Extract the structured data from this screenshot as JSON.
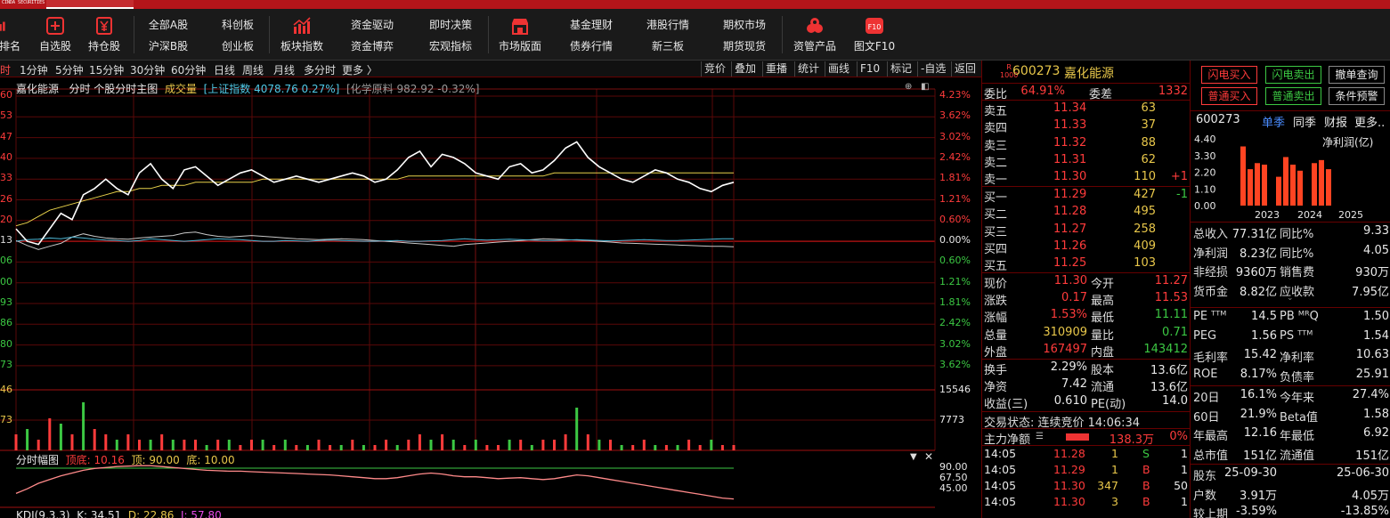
{
  "app": {
    "brand": "CINDA SECURITIES",
    "toolbar": {
      "rank": "排名",
      "watchlist": "自选股",
      "holdings": "持仓股",
      "all_a": "全部A股",
      "sh_sz_b": "沪深B股",
      "star": "科创板",
      "gem": "创业板",
      "sector_index": "板块指数",
      "capital_drive": "资金驱动",
      "capital_game": "资金博弈",
      "instant": "即时决策",
      "macro": "宏观指标",
      "market_board": "市场版面",
      "fund": "基金理财",
      "bond": "债券行情",
      "hk": "港股行情",
      "neeq": "新三板",
      "options": "期权市场",
      "futures": "期货现货",
      "asset_mgmt": "资管产品",
      "f10": "图文F10"
    }
  },
  "periods": {
    "items": [
      "时",
      "1分钟",
      "5分钟",
      "15分钟",
      "30分钟",
      "60分钟",
      "日线",
      "周线",
      "月线",
      "多分时",
      "更多 〉"
    ],
    "tools": [
      "竞价",
      "叠加",
      "重播",
      "统计",
      "画线",
      "F10",
      "标记",
      "-自选",
      "返回"
    ]
  },
  "chart_header": {
    "stock": "嘉化能源",
    "mode": "分时 个股分时主图",
    "vol": "成交量",
    "sh_index": "[上证指数 4078.76 0.27%]",
    "sector": "[化学原料 982.92 -0.32%]"
  },
  "chart_data": {
    "type": "line",
    "left_price_ticks": [
      "60",
      "53",
      "47",
      "40",
      "33",
      "26",
      "20",
      "13",
      "06",
      "00",
      "93",
      "86",
      "80",
      "73"
    ],
    "right_pct_ticks": [
      "4.23%",
      "3.62%",
      "3.02%",
      "2.42%",
      "1.81%",
      "1.21%",
      "0.60%",
      "0.00%",
      "0.60%",
      "1.21%",
      "1.81%",
      "2.42%",
      "3.02%",
      "3.62%"
    ],
    "volume_left_ticks": [
      "46",
      "73"
    ],
    "volume_right_ticks": [
      "15546",
      "7773"
    ],
    "price_series": [
      11.17,
      11.13,
      11.12,
      11.17,
      11.22,
      11.2,
      11.28,
      11.3,
      11.33,
      11.3,
      11.28,
      11.35,
      11.38,
      11.33,
      11.3,
      11.36,
      11.37,
      11.34,
      11.31,
      11.33,
      11.35,
      11.36,
      11.34,
      11.32,
      11.33,
      11.34,
      11.33,
      11.32,
      11.33,
      11.34,
      11.35,
      11.34,
      11.32,
      11.33,
      11.36,
      11.4,
      11.42,
      11.37,
      11.41,
      11.4,
      11.38,
      11.35,
      11.34,
      11.33,
      11.37,
      11.38,
      11.35,
      11.36,
      11.39,
      11.43,
      11.45,
      11.4,
      11.37,
      11.35,
      11.33,
      11.32,
      11.34,
      11.36,
      11.35,
      11.33,
      11.32,
      11.3,
      11.29,
      11.31,
      11.32
    ],
    "avg_series": [
      11.18,
      11.19,
      11.21,
      11.23,
      11.24,
      11.25,
      11.26,
      11.27,
      11.28,
      11.29,
      11.29,
      11.3,
      11.3,
      11.31,
      11.31,
      11.31,
      11.32,
      11.32,
      11.32,
      11.32,
      11.32,
      11.32,
      11.33,
      11.33,
      11.33,
      11.33,
      11.33,
      11.33,
      11.33,
      11.33,
      11.33,
      11.33,
      11.33,
      11.33,
      11.33,
      11.34,
      11.34,
      11.34,
      11.34,
      11.34,
      11.34,
      11.34,
      11.34,
      11.34,
      11.34,
      11.34,
      11.34,
      11.34,
      11.35,
      11.35,
      11.35,
      11.35,
      11.35,
      11.35,
      11.35,
      11.35,
      11.35,
      11.35,
      11.35,
      11.35,
      11.35,
      11.35,
      11.35,
      11.35,
      11.35
    ],
    "index_series": [
      0.0,
      0.04,
      0.05,
      0.08,
      0.06,
      0.1,
      0.08,
      0.05,
      0.03,
      0.02,
      0.0,
      0.02,
      0.06,
      0.04,
      0.02,
      0.0,
      0.02,
      0.04,
      0.06,
      0.05,
      0.04,
      0.02,
      0.0,
      0.0,
      0.02,
      0.01,
      0.0,
      0.02,
      0.03,
      0.02,
      0.01,
      0.0,
      0.0,
      0.01,
      0.02,
      0.0,
      0.0,
      0.01,
      0.02,
      0.04,
      0.06,
      0.04,
      0.03,
      0.04,
      0.05,
      0.04,
      0.03,
      0.02,
      0.02,
      0.03,
      0.04,
      0.03,
      0.02,
      0.01,
      0.02,
      0.03,
      0.04,
      0.03,
      0.02,
      0.02,
      0.03,
      0.04,
      0.05,
      0.06,
      0.06
    ],
    "sector_series": [
      0.02,
      -0.1,
      -0.2,
      -0.12,
      -0.05,
      0.1,
      0.18,
      0.12,
      0.08,
      0.06,
      0.05,
      0.08,
      0.1,
      0.12,
      0.14,
      0.2,
      0.22,
      0.16,
      0.12,
      0.1,
      0.12,
      0.14,
      0.12,
      0.1,
      0.08,
      0.06,
      0.05,
      0.04,
      0.05,
      0.06,
      0.05,
      0.04,
      0.02,
      0.0,
      -0.02,
      -0.04,
      -0.06,
      -0.08,
      -0.1,
      -0.12,
      -0.08,
      -0.06,
      -0.04,
      -0.02,
      0.0,
      0.02,
      0.04,
      0.06,
      0.05,
      0.04,
      0.03,
      0.02,
      0.0,
      -0.02,
      -0.04,
      -0.05,
      -0.06,
      -0.07,
      -0.08,
      -0.09,
      -0.1,
      -0.11,
      -0.12,
      -0.12,
      -0.13
    ],
    "volume": [
      3,
      4,
      2,
      6,
      5,
      3,
      9,
      4,
      3,
      2,
      3,
      2,
      2,
      3,
      2,
      2,
      2,
      1,
      2,
      2,
      1,
      2,
      2,
      1,
      2,
      1,
      1,
      2,
      1,
      1,
      2,
      1,
      1,
      2,
      1,
      2,
      3,
      2,
      3,
      2,
      1,
      2,
      1,
      1,
      2,
      2,
      1,
      2,
      2,
      3,
      8,
      3,
      2,
      2,
      1,
      1,
      2,
      1,
      1,
      1,
      2,
      1,
      2,
      1,
      1
    ],
    "volume_up": [
      true,
      false,
      true,
      true,
      false,
      true,
      false,
      true,
      true,
      false,
      true,
      true,
      false,
      true,
      false,
      true,
      true,
      false,
      true,
      false,
      true,
      true,
      false,
      true,
      false,
      true,
      false,
      true,
      true,
      false,
      true,
      false,
      true,
      true,
      false,
      true,
      true,
      false,
      true,
      false,
      true,
      false,
      true,
      true,
      false,
      true,
      false,
      true,
      true,
      true,
      false,
      true,
      false,
      true,
      false,
      true,
      true,
      false,
      true,
      false,
      true,
      true,
      false,
      true,
      true
    ],
    "amplitude_series": [
      30,
      40,
      52,
      60,
      68,
      74,
      80,
      84,
      86,
      88,
      89,
      90,
      90,
      88,
      86,
      84,
      82,
      80,
      79,
      78,
      78,
      77,
      76,
      75,
      74,
      73,
      72,
      71,
      70,
      68,
      66,
      64,
      62,
      62,
      64,
      68,
      72,
      74,
      72,
      68,
      66,
      66,
      64,
      62,
      63,
      64,
      62,
      60,
      62,
      66,
      70,
      68,
      64,
      60,
      56,
      52,
      48,
      44,
      40,
      36,
      32,
      28,
      24,
      20,
      18
    ],
    "amplitude_labels": [
      "90.00",
      "67.50",
      "45.00"
    ],
    "sub_legend": {
      "title": "分时幅图",
      "top": "顶底: 10.16",
      "top2": "顶: 90.00",
      "bottom": "底: 10.00"
    },
    "kdj": {
      "title": "KDJ(9,3,3)",
      "k": "K: 34.51",
      "d": "D: 22.86",
      "j": "J: 57.80"
    }
  },
  "quote": {
    "code": "600273",
    "name": "嘉化能源",
    "mark": "R\n1000",
    "ratio_label": "委比",
    "ratio_val": "64.91%",
    "diff_label": "委差",
    "diff_val": "1332",
    "asks": [
      {
        "lv": "卖五",
        "px": "11.34",
        "qty": "63",
        "chg": ""
      },
      {
        "lv": "卖四",
        "px": "11.33",
        "qty": "37",
        "chg": ""
      },
      {
        "lv": "卖三",
        "px": "11.32",
        "qty": "88",
        "chg": ""
      },
      {
        "lv": "卖二",
        "px": "11.31",
        "qty": "62",
        "chg": ""
      },
      {
        "lv": "卖一",
        "px": "11.30",
        "qty": "110",
        "chg": "+1"
      }
    ],
    "bids": [
      {
        "lv": "买一",
        "px": "11.29",
        "qty": "427",
        "chg": "-1"
      },
      {
        "lv": "买二",
        "px": "11.28",
        "qty": "495",
        "chg": ""
      },
      {
        "lv": "买三",
        "px": "11.27",
        "qty": "258",
        "chg": ""
      },
      {
        "lv": "买四",
        "px": "11.26",
        "qty": "409",
        "chg": ""
      },
      {
        "lv": "买五",
        "px": "11.25",
        "qty": "103",
        "chg": ""
      }
    ],
    "stats": [
      {
        "l1": "现价",
        "v1": "11.30",
        "c1": "red",
        "l2": "今开",
        "v2": "11.27",
        "c2": "red"
      },
      {
        "l1": "涨跌",
        "v1": "0.17",
        "c1": "red",
        "l2": "最高",
        "v2": "11.53",
        "c2": "red"
      },
      {
        "l1": "涨幅",
        "v1": "1.53%",
        "c1": "red",
        "l2": "最低",
        "v2": "11.11",
        "c2": "grn"
      },
      {
        "l1": "总量",
        "v1": "310909",
        "c1": "yel",
        "l2": "量比",
        "v2": "0.71",
        "c2": "grn"
      },
      {
        "l1": "外盘",
        "v1": "167497",
        "c1": "red",
        "l2": "内盘",
        "v2": "143412",
        "c2": "grn"
      }
    ],
    "stats2": [
      {
        "l1": "换手",
        "v1": "2.29%",
        "c1": "wht",
        "l2": "股本",
        "v2": "13.6亿",
        "c2": "wht"
      },
      {
        "l1": "净资",
        "v1": "7.42",
        "c1": "wht",
        "l2": "流通",
        "v2": "13.6亿",
        "c2": "wht"
      },
      {
        "l1": "收益(三)",
        "v1": "0.610",
        "c1": "wht",
        "l2": "PE(动)",
        "v2": "14.0",
        "c2": "wht"
      }
    ],
    "status": "交易状态: 连续竞价 14:06:34",
    "main_flow_label": "主力净额",
    "main_flow_val": "138.3万",
    "main_flow_pct": "0%",
    "ticks": [
      {
        "t": "14:05",
        "p": "11.28",
        "q": "1",
        "s": "S",
        "n": "1"
      },
      {
        "t": "14:05",
        "p": "11.29",
        "q": "1",
        "s": "B",
        "n": "1"
      },
      {
        "t": "14:05",
        "p": "11.30",
        "q": "347",
        "s": "B",
        "n": "50"
      },
      {
        "t": "14:05",
        "p": "11.30",
        "q": "3",
        "s": "B",
        "n": "1"
      }
    ]
  },
  "finance": {
    "buttons": {
      "flash_buy": "闪电买入",
      "flash_sell": "闪电卖出",
      "cancel_query": "撤单查询",
      "normal_buy": "普通买入",
      "normal_sell": "普通卖出",
      "cond_alert": "条件预警"
    },
    "tabs": {
      "code": "600273",
      "single": "单季",
      "yoy": "同季",
      "report": "财报",
      "more": "更多.."
    },
    "chart": {
      "unit": "净利润(亿)",
      "y_ticks": [
        "4.40",
        "3.30",
        "2.20",
        "1.10",
        "0.00"
      ],
      "years": [
        "2023",
        "2024",
        "2025"
      ],
      "values": [
        3.9,
        2.4,
        2.8,
        2.7,
        0,
        1.9,
        3.2,
        2.7,
        2.3,
        0,
        2.8,
        3.0,
        2.4
      ],
      "bar_color": "#ff4422"
    },
    "rows": [
      {
        "l1": "总收入",
        "v1": "77.31亿",
        "l2": "同比%",
        "v2": "9.33"
      },
      {
        "l1": "净利润",
        "v1": "8.23亿",
        "l2": "同比%",
        "v2": "4.05"
      },
      {
        "l1": "非经损",
        "v1": "9360万",
        "l2": "销售费",
        "v2": "930万"
      },
      {
        "l1": "货币金",
        "v1": "8.82亿",
        "l2": "应收款",
        "v2": "7.95亿"
      }
    ],
    "rows2": [
      {
        "l1": "PE ᵀᵀᴹ",
        "v1": "14.5",
        "l2": "PB ᴹᴿQ",
        "v2": "1.50"
      },
      {
        "l1": "PEG",
        "v1": "1.56",
        "l2": "PS ᵀᵀᴹ",
        "v2": "1.54"
      },
      {
        "l1": "毛利率",
        "v1": "15.42",
        "l2": "净利率",
        "v2": "10.63"
      },
      {
        "l1": "ROE",
        "v1": "8.17%",
        "l2": "负债率",
        "v2": "25.91"
      }
    ],
    "rows3": [
      {
        "l1": "20日",
        "v1": "16.1%",
        "l2": "今年来",
        "v2": "27.4%"
      },
      {
        "l1": "60日",
        "v1": "21.9%",
        "l2": "Beta值",
        "v2": "1.58"
      },
      {
        "l1": "年最高",
        "v1": "12.16",
        "l2": "年最低",
        "v2": "6.92"
      },
      {
        "l1": "总市值",
        "v1": "151亿",
        "l2": "流通值",
        "v2": "151亿"
      }
    ],
    "rows4": [
      {
        "l1": "股东",
        "v1": "25-09-30",
        "l2": "",
        "v2": "25-06-30"
      },
      {
        "l1": "户数",
        "v1": "3.91万",
        "l2": "",
        "v2": "4.05万"
      },
      {
        "l1": "较上期",
        "v1": "-3.59%",
        "l2": "",
        "v2": "-13.85%"
      }
    ]
  }
}
